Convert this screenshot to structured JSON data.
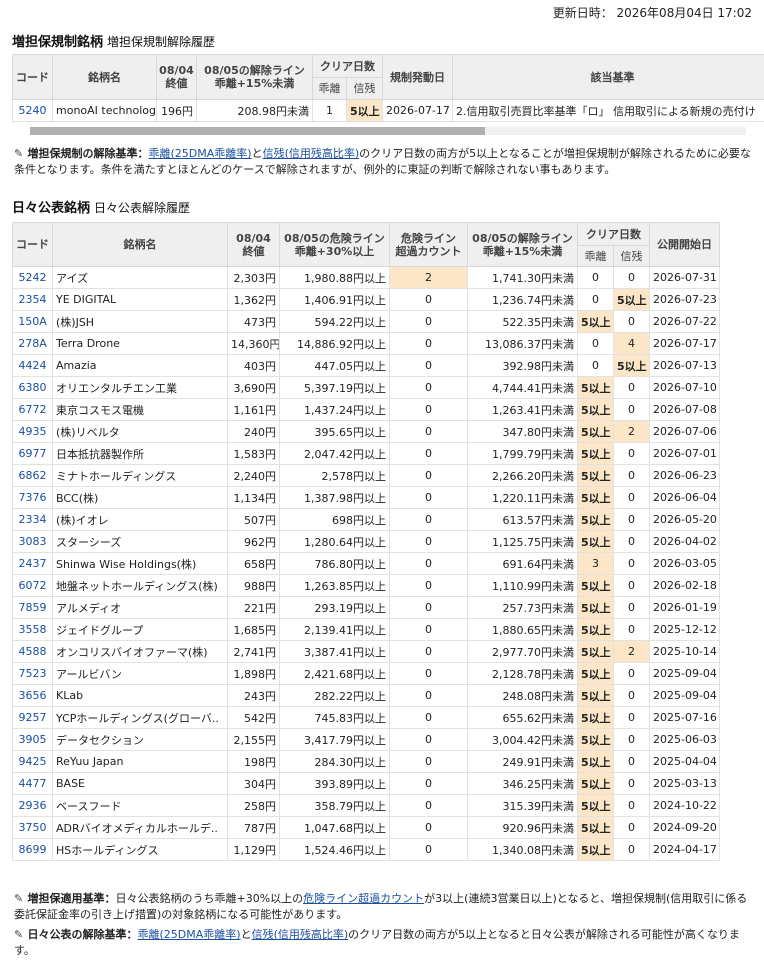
{
  "update": "更新日時： 2026年08月04日 17:02",
  "sec1": {
    "title": "増担保規制銘柄",
    "link": "増担保規制解除履歴",
    "h_code": "コード",
    "h_name": "銘柄名",
    "h_price_1": "08/04",
    "h_price_2": "終値",
    "h_line_1": "08/05の解除ライン",
    "h_line_2": "乖離+15%未満",
    "h_clear": "クリア日数",
    "h_kairi": "乖離",
    "h_shinzan": "信残",
    "h_date": "規制発動日",
    "h_criteria": "該当基準",
    "row": {
      "code": "5240",
      "name": "monoAI technology",
      "price": "196円",
      "line": "208.98円未満",
      "kairi": "1",
      "shinzan": "5以上",
      "date": "2026-07-17",
      "criteria": "2.信用取引売買比率基準「ロ」 信用取引による新規の売付け"
    }
  },
  "note1": {
    "label": "増担保規制の解除基準：",
    "link1": "乖離(25DMA乖離率)",
    "mid": "と",
    "link2": "信残(信用残高比率)",
    "text": "のクリア日数の両方が5以上となることが増担保規制が解除されるために必要な条件となります。条件を満たすとほとんどのケースで解除されますが、例外的に東証の判断で解除されない事もあります。"
  },
  "sec2": {
    "title": "日々公表銘柄",
    "link": "日々公表解除履歴",
    "h_code": "コード",
    "h_name": "銘柄名",
    "h_price_1": "08/04",
    "h_price_2": "終値",
    "h_danger_1": "08/05の危険ライン",
    "h_danger_2": "乖離+30%以上",
    "h_over_1": "危険ライン",
    "h_over_2": "超過カウント",
    "h_line_1": "08/05の解除ライン",
    "h_line_2": "乖離+15%未満",
    "h_clear": "クリア日数",
    "h_kairi": "乖離",
    "h_shinzan": "信残",
    "h_date": "公開開始日",
    "rows": [
      {
        "code": "5242",
        "name": "アイズ",
        "price": "2,303円",
        "danger": "1,980.88円以上",
        "over": "2",
        "line": "1,741.30円未満",
        "kairi": "0",
        "shinzan": "0",
        "date": "2026-07-31"
      },
      {
        "code": "2354",
        "name": "YE DIGITAL",
        "price": "1,362円",
        "danger": "1,406.91円以上",
        "over": "0",
        "line": "1,236.74円未満",
        "kairi": "0",
        "shinzan": "5以上",
        "date": "2026-07-23"
      },
      {
        "code": "150A",
        "name": "(株)JSH",
        "price": "473円",
        "danger": "594.22円以上",
        "over": "0",
        "line": "522.35円未満",
        "kairi": "5以上",
        "shinzan": "0",
        "date": "2026-07-22"
      },
      {
        "code": "278A",
        "name": "Terra Drone",
        "price": "14,360円",
        "danger": "14,886.92円以上",
        "over": "0",
        "line": "13,086.37円未満",
        "kairi": "0",
        "shinzan": "4",
        "date": "2026-07-17"
      },
      {
        "code": "4424",
        "name": "Amazia",
        "price": "403円",
        "danger": "447.05円以上",
        "over": "0",
        "line": "392.98円未満",
        "kairi": "0",
        "shinzan": "5以上",
        "date": "2026-07-13"
      },
      {
        "code": "6380",
        "name": "オリエンタルチエン工業",
        "price": "3,690円",
        "danger": "5,397.19円以上",
        "over": "0",
        "line": "4,744.41円未満",
        "kairi": "5以上",
        "shinzan": "0",
        "date": "2026-07-10"
      },
      {
        "code": "6772",
        "name": "東京コスモス電機",
        "price": "1,161円",
        "danger": "1,437.24円以上",
        "over": "0",
        "line": "1,263.41円未満",
        "kairi": "5以上",
        "shinzan": "0",
        "date": "2026-07-08"
      },
      {
        "code": "4935",
        "name": "(株)リベルタ",
        "price": "240円",
        "danger": "395.65円以上",
        "over": "0",
        "line": "347.80円未満",
        "kairi": "5以上",
        "shinzan": "2",
        "date": "2026-07-06"
      },
      {
        "code": "6977",
        "name": "日本抵抗器製作所",
        "price": "1,583円",
        "danger": "2,047.42円以上",
        "over": "0",
        "line": "1,799.79円未満",
        "kairi": "5以上",
        "shinzan": "0",
        "date": "2026-07-01"
      },
      {
        "code": "6862",
        "name": "ミナトホールディングス",
        "price": "2,240円",
        "danger": "2,578円以上",
        "over": "0",
        "line": "2,266.20円未満",
        "kairi": "5以上",
        "shinzan": "0",
        "date": "2026-06-23"
      },
      {
        "code": "7376",
        "name": "BCC(株)",
        "price": "1,134円",
        "danger": "1,387.98円以上",
        "over": "0",
        "line": "1,220.11円未満",
        "kairi": "5以上",
        "shinzan": "0",
        "date": "2026-06-04"
      },
      {
        "code": "2334",
        "name": "(株)イオレ",
        "price": "507円",
        "danger": "698円以上",
        "over": "0",
        "line": "613.57円未満",
        "kairi": "5以上",
        "shinzan": "0",
        "date": "2026-05-20"
      },
      {
        "code": "3083",
        "name": "スターシーズ",
        "price": "962円",
        "danger": "1,280.64円以上",
        "over": "0",
        "line": "1,125.75円未満",
        "kairi": "5以上",
        "shinzan": "0",
        "date": "2026-04-02"
      },
      {
        "code": "2437",
        "name": "Shinwa Wise Holdings(株)",
        "price": "658円",
        "danger": "786.80円以上",
        "over": "0",
        "line": "691.64円未満",
        "kairi": "3",
        "shinzan": "0",
        "date": "2026-03-05"
      },
      {
        "code": "6072",
        "name": "地盤ネットホールディングス(株)",
        "price": "988円",
        "danger": "1,263.85円以上",
        "over": "0",
        "line": "1,110.99円未満",
        "kairi": "5以上",
        "shinzan": "0",
        "date": "2026-02-18"
      },
      {
        "code": "7859",
        "name": "アルメディオ",
        "price": "221円",
        "danger": "293.19円以上",
        "over": "0",
        "line": "257.73円未満",
        "kairi": "5以上",
        "shinzan": "0",
        "date": "2026-01-19"
      },
      {
        "code": "3558",
        "name": "ジェイドグループ",
        "price": "1,685円",
        "danger": "2,139.41円以上",
        "over": "0",
        "line": "1,880.65円未満",
        "kairi": "5以上",
        "shinzan": "0",
        "date": "2025-12-12"
      },
      {
        "code": "4588",
        "name": "オンコリスバイオファーマ(株)",
        "price": "2,741円",
        "danger": "3,387.41円以上",
        "over": "0",
        "line": "2,977.70円未満",
        "kairi": "5以上",
        "shinzan": "2",
        "date": "2025-10-14"
      },
      {
        "code": "7523",
        "name": "アールビバン",
        "price": "1,898円",
        "danger": "2,421.68円以上",
        "over": "0",
        "line": "2,128.78円未満",
        "kairi": "5以上",
        "shinzan": "0",
        "date": "2025-09-04"
      },
      {
        "code": "3656",
        "name": "KLab",
        "price": "243円",
        "danger": "282.22円以上",
        "over": "0",
        "line": "248.08円未満",
        "kairi": "5以上",
        "shinzan": "0",
        "date": "2025-09-04"
      },
      {
        "code": "9257",
        "name": "YCPホールディングス(グローバ..",
        "price": "542円",
        "danger": "745.83円以上",
        "over": "0",
        "line": "655.62円未満",
        "kairi": "5以上",
        "shinzan": "0",
        "date": "2025-07-16"
      },
      {
        "code": "3905",
        "name": "データセクション",
        "price": "2,155円",
        "danger": "3,417.79円以上",
        "over": "0",
        "line": "3,004.42円未満",
        "kairi": "5以上",
        "shinzan": "0",
        "date": "2025-06-03"
      },
      {
        "code": "9425",
        "name": "ReYuu Japan",
        "price": "198円",
        "danger": "284.30円以上",
        "over": "0",
        "line": "249.91円未満",
        "kairi": "5以上",
        "shinzan": "0",
        "date": "2025-04-04"
      },
      {
        "code": "4477",
        "name": "BASE",
        "price": "304円",
        "danger": "393.89円以上",
        "over": "0",
        "line": "346.25円未満",
        "kairi": "5以上",
        "shinzan": "0",
        "date": "2025-03-13"
      },
      {
        "code": "2936",
        "name": "ベースフード",
        "price": "258円",
        "danger": "358.79円以上",
        "over": "0",
        "line": "315.39円未満",
        "kairi": "5以上",
        "shinzan": "0",
        "date": "2024-10-22"
      },
      {
        "code": "3750",
        "name": "ADRバイオメディカルホールデ..",
        "price": "787円",
        "danger": "1,047.68円以上",
        "over": "0",
        "line": "920.96円未満",
        "kairi": "5以上",
        "shinzan": "0",
        "date": "2024-09-20"
      },
      {
        "code": "8699",
        "name": "HSホールディングス",
        "price": "1,129円",
        "danger": "1,524.46円以上",
        "over": "0",
        "line": "1,340.08円未満",
        "kairi": "5以上",
        "shinzan": "0",
        "date": "2024-04-17"
      }
    ]
  },
  "note2": {
    "label": "増担保適用基準：",
    "pre": "日々公表銘柄のうち乖離+30%以上の",
    "link": "危険ライン超過カウント",
    "text": "が3以上(連続3営業日以上)となると、増担保規制(信用取引に係る委託保証金率の引き上げ措置)の対象銘柄になる可能性があります。"
  },
  "note3": {
    "label": "日々公表の解除基準：",
    "link1": "乖離(25DMA乖離率)",
    "mid": "と",
    "link2": "信残(信用残高比率)",
    "text": "のクリア日数の両方が5以上となると日々公表が解除される可能性が高くなります。"
  }
}
